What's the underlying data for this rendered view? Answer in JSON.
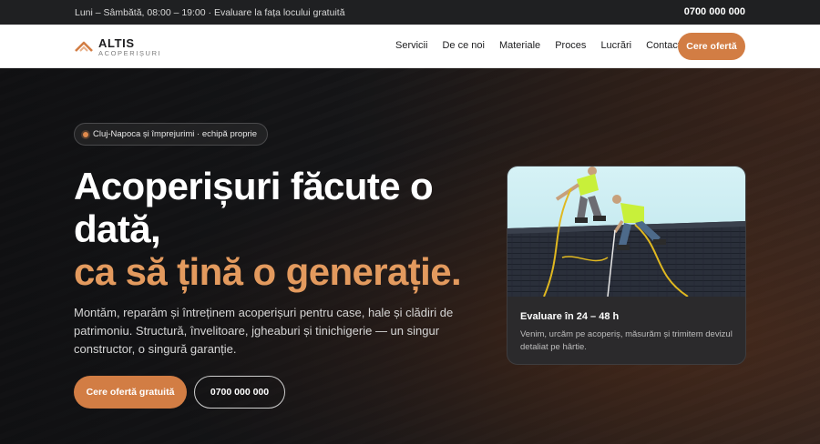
{
  "topbar": {
    "hours": "Luni – Sâmbătă, 08:00 – 19:00 · Evaluare la fața locului gratuită",
    "phone": "0700 000 000"
  },
  "brand": {
    "name": "ALTIS",
    "subtitle": "ACOPERIȘURI",
    "accent": "#d27d44"
  },
  "nav": {
    "items": [
      {
        "label": "Servicii"
      },
      {
        "label": "De ce noi"
      },
      {
        "label": "Materiale"
      },
      {
        "label": "Proces"
      },
      {
        "label": "Lucrări"
      },
      {
        "label": "Contact"
      }
    ],
    "cta": "Cere ofertă"
  },
  "hero": {
    "badge": "Cluj-Napoca și împrejurimi · echipă proprie",
    "title_line1": "Acoperișuri făcute o",
    "title_line2": "dată,",
    "title_highlight": "ca să țină o generație.",
    "lead": "Montăm, reparăm și întreținem acoperișuri pentru case, hale și clădiri de patrimoniu. Structură, învelitoare, jgheaburi și tinichigerie — un singur constructor, o singură garanție.",
    "primary_button": "Cere ofertă gratuită",
    "secondary_button": "0700 000 000"
  },
  "card": {
    "title": "Evaluare în 24 – 48 h",
    "text": "Venim, urcăm pe acoperiș, măsurăm și trimitem devizul detaliat pe hârtie."
  }
}
